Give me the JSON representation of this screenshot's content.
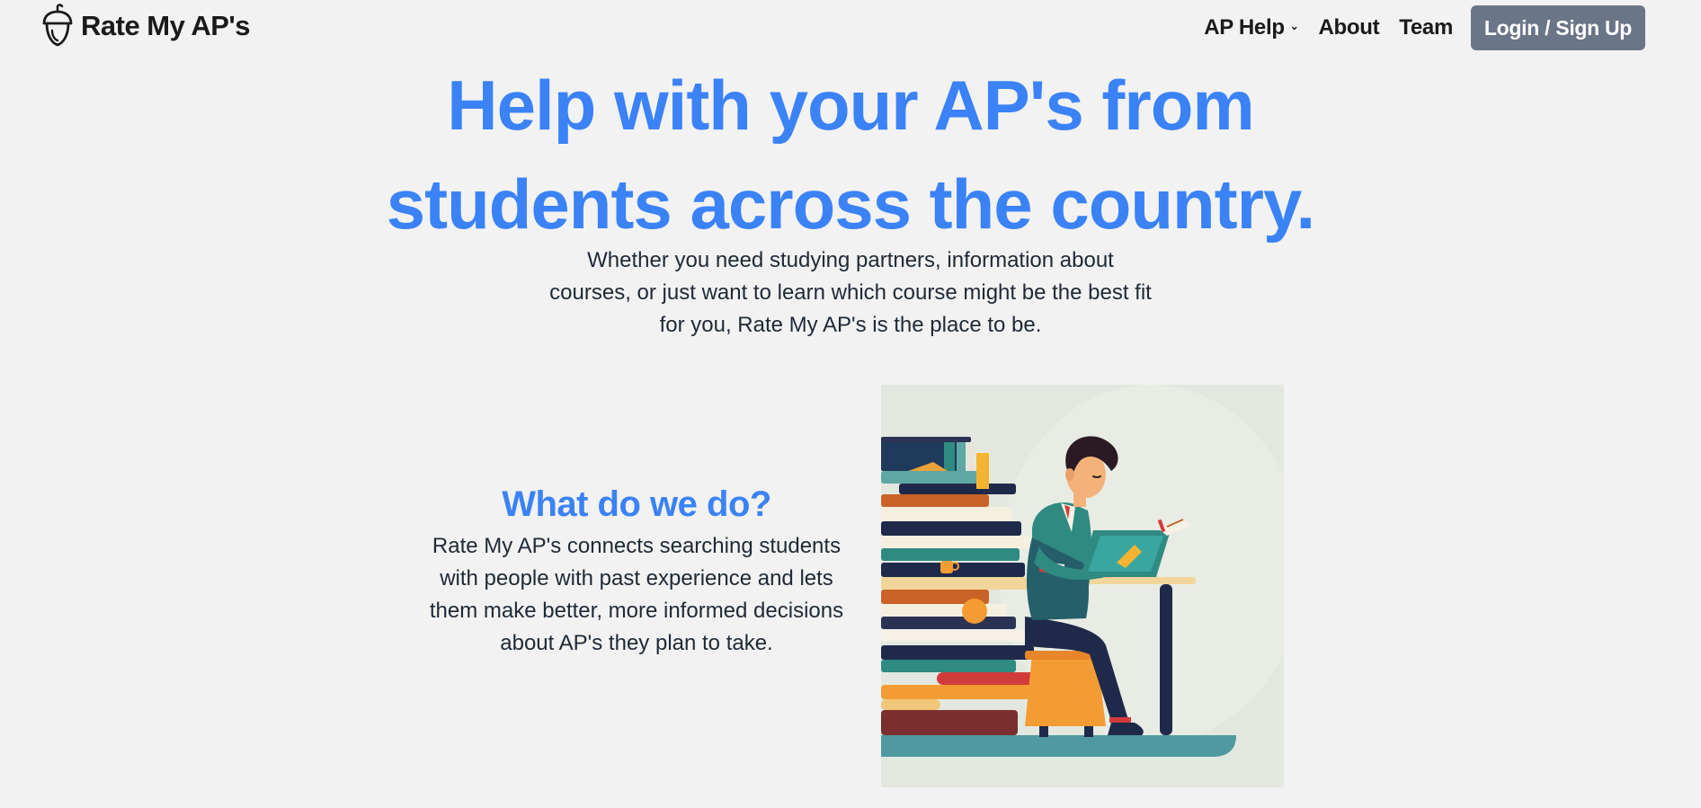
{
  "nav": {
    "brand": "Rate My AP's",
    "links": {
      "ap_help": "AP Help",
      "about": "About",
      "team": "Team"
    },
    "login_label": "Login / Sign Up"
  },
  "hero": {
    "title_line1": "Help with your AP's from",
    "title_line2": "students across the country.",
    "subtitle": "Whether you need studying partners, information about courses, or just want to learn which course might be the best fit for you, Rate My AP's is the place to be."
  },
  "about_section": {
    "heading": "What do we do?",
    "body": "Rate My AP's connects searching students with people with past experience and lets them make better, more informed decisions about AP's they plan to take."
  },
  "colors": {
    "accent": "#3b82f6",
    "login_button": "#6b7588",
    "background": "#f2f2f2"
  },
  "icons": {
    "brand": "acorn-icon",
    "dropdown": "chevron-down-icon"
  }
}
